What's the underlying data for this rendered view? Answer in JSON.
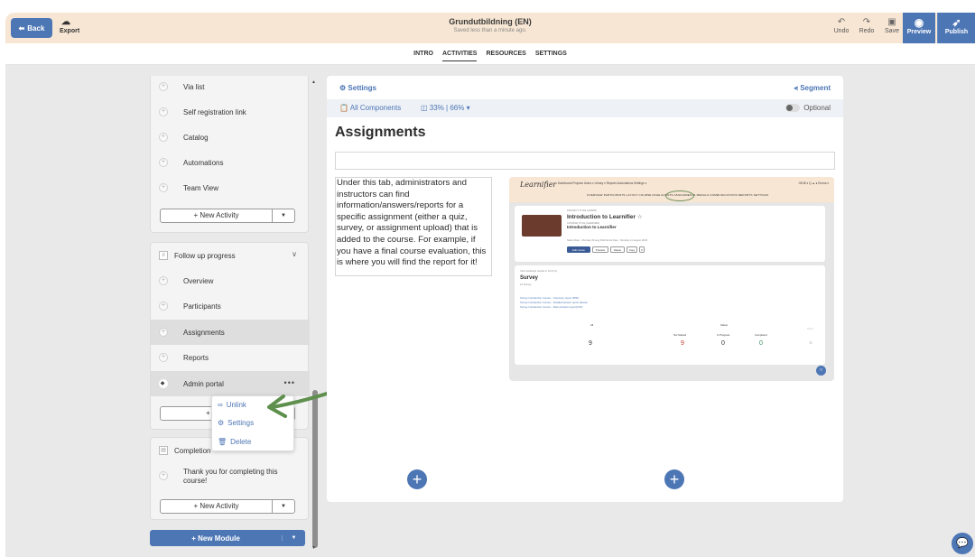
{
  "header": {
    "back_label": "Back",
    "export_label": "Export",
    "title": "Grundutbildning (EN)",
    "subtitle": "Saved less than a minute ago.",
    "undo_label": "Undo",
    "redo_label": "Redo",
    "save_label": "Save",
    "preview_label": "Preview",
    "publish_label": "Publish"
  },
  "tabs": [
    {
      "label": "INTRO"
    },
    {
      "label": "ACTIVITIES"
    },
    {
      "label": "RESOURCES"
    },
    {
      "label": "SETTINGS"
    }
  ],
  "sidebar": {
    "module1_items": [
      {
        "label": "Via list"
      },
      {
        "label": "Self registration link"
      },
      {
        "label": "Catalog"
      },
      {
        "label": "Automations"
      },
      {
        "label": "Team View"
      }
    ],
    "new_activity_label": "+ New Activity",
    "module2_title": "Follow up progress",
    "module2_items": [
      {
        "label": "Overview"
      },
      {
        "label": "Participants"
      },
      {
        "label": "Assignments"
      },
      {
        "label": "Reports"
      },
      {
        "label": "Admin portal"
      }
    ],
    "module2_new_activity_partial": "+ New",
    "module3_title_partial": "Completion",
    "module3_items": [
      {
        "label": "Thank you for completing this course!"
      }
    ],
    "new_module_label": "+ New Module"
  },
  "context_menu": {
    "unlink": "Unlink",
    "settings": "Settings",
    "delete": "Delete"
  },
  "panel": {
    "settings_label": "Settings",
    "segment_label": "Segment",
    "all_components_label": "All Components",
    "ratio_label": "33% | 66%",
    "optional_label": "Optional",
    "heading": "Assignments",
    "text": "Under this tab, administrators and instructors can find information/answers/reports for a specific assignment (either a quiz, survey, or assignment upload) that is added to the course. For example, if you have a final course evaluation, this is where you will find the report for it!"
  },
  "mini": {
    "logo": "Learnifier",
    "nav": "Dashboard  Projects  Users ▾  Library ▾  Reports  Automations  Settings ▾",
    "right": "Gå till ▾   Q   ▲   ●   Emma ▾",
    "tabs": "OVERVIEW   PARTICIPANTS   LAYOUT   COURSE PAGE   EVENTS   ASSIGNMENTS   MEDALS   COMMUNICATIONS   REPORTS   SETTINGS",
    "project_type": "PROJECT TITLE (ADMIN)",
    "project_title": "Introduction to Learnifier",
    "course_title_small": "COURSE TITLE (LEARNER)",
    "course_title": "Introduction to Learnifier",
    "dates": "Starts Date · Monday 29 aug 2022      Ends Date · Monday 14 august 2023",
    "btn_edit": "Edit course",
    "btn_preview": "Preview",
    "btn_delete": "Delete",
    "btn_copy": "Copy",
    "survey_small": "View feedback results in full (6.2)",
    "survey_title": "Survey",
    "survey_sub": "14 Survey",
    "link1": "Survey Introduction Course – Summary report (PDF)",
    "link2": "Survey Introduction Course – Detailed answer report (Excel)",
    "link3": "Survey Introduction Course – Raw answers report(CSV)",
    "all_label": "All",
    "status_label": "Status",
    "not_started": "Not Started",
    "in_progress": "In Progress",
    "completed": "Completed",
    "clear": "Clear",
    "n_all": "9",
    "n_not_started": "9",
    "n_in_progress": "0",
    "n_completed": "0",
    "n_clear": "×"
  },
  "icons": {
    "back": "arrow-left-icon",
    "export": "cloud-download-icon",
    "undo": "undo-icon",
    "redo": "redo-icon",
    "save": "save-icon",
    "preview": "eye-icon",
    "publish": "rocket-icon",
    "settings": "gear-icon",
    "segment": "segment-icon",
    "chat": "chat-icon"
  },
  "colors": {
    "accent": "#4d76b5",
    "header_bg": "#f7e6d3",
    "arrow": "#5e8f4d"
  }
}
